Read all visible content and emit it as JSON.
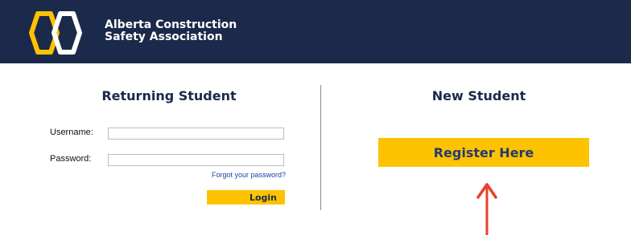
{
  "header": {
    "org_name_line1": "Alberta Construction",
    "org_name_line2": "Safety Association",
    "logo_icon": "hexagon-logo-icon",
    "background_color": "#1b2a4a",
    "logo_colors": [
      "#fdc300",
      "#ffffff"
    ]
  },
  "returning": {
    "title": "Returning Student",
    "username_label": "Username:",
    "username_value": "",
    "password_label": "Password:",
    "password_value": "",
    "forgot_label": "Forgot your password?",
    "login_label": "Login"
  },
  "new_student": {
    "title": "New Student",
    "register_label": "Register Here"
  },
  "annotation": {
    "arrow_icon": "up-arrow-icon",
    "arrow_color": "#e8402a"
  },
  "colors": {
    "accent": "#fdc300",
    "link": "#1f3da8"
  }
}
